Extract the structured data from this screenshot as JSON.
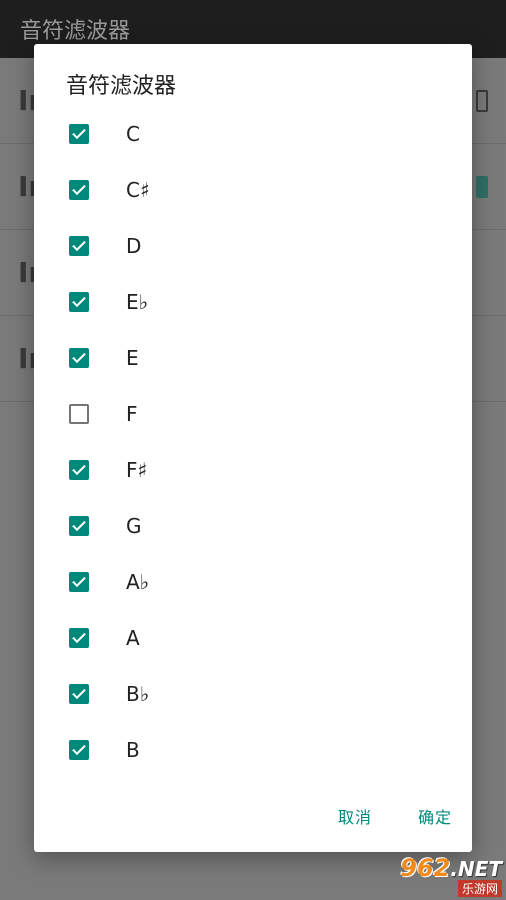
{
  "app": {
    "title": "音符滤波器",
    "rows": [
      {
        "text": "In",
        "toggle": false
      },
      {
        "text": "In",
        "toggle": true
      },
      {
        "text": "In",
        "toggle": false
      },
      {
        "text": "In",
        "toggle": false
      }
    ]
  },
  "dialog": {
    "title": "音符滤波器",
    "options": [
      {
        "label": "C",
        "checked": true
      },
      {
        "label": "C♯",
        "checked": true
      },
      {
        "label": "D",
        "checked": true
      },
      {
        "label": "E♭",
        "checked": true
      },
      {
        "label": "E",
        "checked": true
      },
      {
        "label": "F",
        "checked": false
      },
      {
        "label": "F♯",
        "checked": true
      },
      {
        "label": "G",
        "checked": true
      },
      {
        "label": "A♭",
        "checked": true
      },
      {
        "label": "A",
        "checked": true
      },
      {
        "label": "B♭",
        "checked": true
      },
      {
        "label": "B",
        "checked": true
      }
    ],
    "cancel_label": "取消",
    "ok_label": "确定"
  },
  "watermark": {
    "number": "962",
    "suffix": ".NET",
    "subtitle": "乐游网"
  },
  "colors": {
    "accent": "#00897b",
    "unchecked_border": "#757575"
  }
}
